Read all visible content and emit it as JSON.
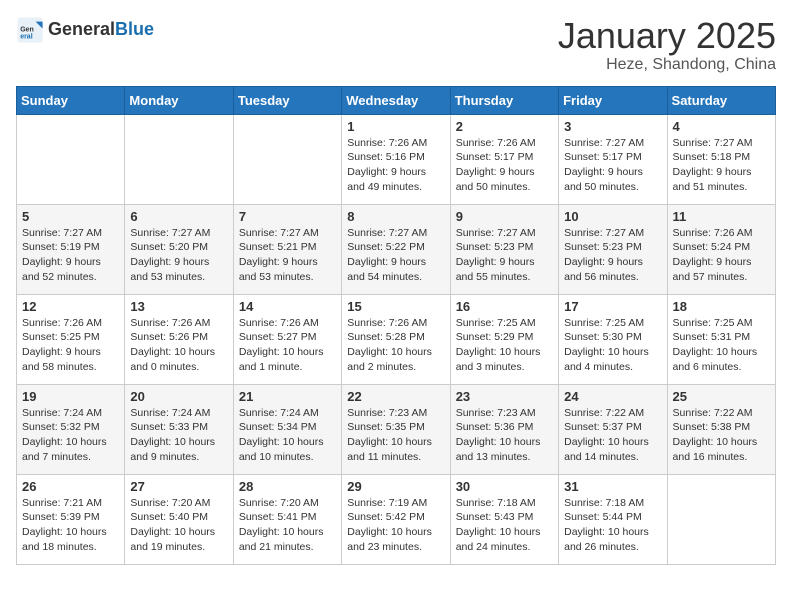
{
  "logo": {
    "general": "General",
    "blue": "Blue"
  },
  "title": "January 2025",
  "location": "Heze, Shandong, China",
  "days_of_week": [
    "Sunday",
    "Monday",
    "Tuesday",
    "Wednesday",
    "Thursday",
    "Friday",
    "Saturday"
  ],
  "weeks": [
    [
      {
        "day": "",
        "info": ""
      },
      {
        "day": "",
        "info": ""
      },
      {
        "day": "",
        "info": ""
      },
      {
        "day": "1",
        "info": "Sunrise: 7:26 AM\nSunset: 5:16 PM\nDaylight: 9 hours\nand 49 minutes."
      },
      {
        "day": "2",
        "info": "Sunrise: 7:26 AM\nSunset: 5:17 PM\nDaylight: 9 hours\nand 50 minutes."
      },
      {
        "day": "3",
        "info": "Sunrise: 7:27 AM\nSunset: 5:17 PM\nDaylight: 9 hours\nand 50 minutes."
      },
      {
        "day": "4",
        "info": "Sunrise: 7:27 AM\nSunset: 5:18 PM\nDaylight: 9 hours\nand 51 minutes."
      }
    ],
    [
      {
        "day": "5",
        "info": "Sunrise: 7:27 AM\nSunset: 5:19 PM\nDaylight: 9 hours\nand 52 minutes."
      },
      {
        "day": "6",
        "info": "Sunrise: 7:27 AM\nSunset: 5:20 PM\nDaylight: 9 hours\nand 53 minutes."
      },
      {
        "day": "7",
        "info": "Sunrise: 7:27 AM\nSunset: 5:21 PM\nDaylight: 9 hours\nand 53 minutes."
      },
      {
        "day": "8",
        "info": "Sunrise: 7:27 AM\nSunset: 5:22 PM\nDaylight: 9 hours\nand 54 minutes."
      },
      {
        "day": "9",
        "info": "Sunrise: 7:27 AM\nSunset: 5:23 PM\nDaylight: 9 hours\nand 55 minutes."
      },
      {
        "day": "10",
        "info": "Sunrise: 7:27 AM\nSunset: 5:23 PM\nDaylight: 9 hours\nand 56 minutes."
      },
      {
        "day": "11",
        "info": "Sunrise: 7:26 AM\nSunset: 5:24 PM\nDaylight: 9 hours\nand 57 minutes."
      }
    ],
    [
      {
        "day": "12",
        "info": "Sunrise: 7:26 AM\nSunset: 5:25 PM\nDaylight: 9 hours\nand 58 minutes."
      },
      {
        "day": "13",
        "info": "Sunrise: 7:26 AM\nSunset: 5:26 PM\nDaylight: 10 hours\nand 0 minutes."
      },
      {
        "day": "14",
        "info": "Sunrise: 7:26 AM\nSunset: 5:27 PM\nDaylight: 10 hours\nand 1 minute."
      },
      {
        "day": "15",
        "info": "Sunrise: 7:26 AM\nSunset: 5:28 PM\nDaylight: 10 hours\nand 2 minutes."
      },
      {
        "day": "16",
        "info": "Sunrise: 7:25 AM\nSunset: 5:29 PM\nDaylight: 10 hours\nand 3 minutes."
      },
      {
        "day": "17",
        "info": "Sunrise: 7:25 AM\nSunset: 5:30 PM\nDaylight: 10 hours\nand 4 minutes."
      },
      {
        "day": "18",
        "info": "Sunrise: 7:25 AM\nSunset: 5:31 PM\nDaylight: 10 hours\nand 6 minutes."
      }
    ],
    [
      {
        "day": "19",
        "info": "Sunrise: 7:24 AM\nSunset: 5:32 PM\nDaylight: 10 hours\nand 7 minutes."
      },
      {
        "day": "20",
        "info": "Sunrise: 7:24 AM\nSunset: 5:33 PM\nDaylight: 10 hours\nand 9 minutes."
      },
      {
        "day": "21",
        "info": "Sunrise: 7:24 AM\nSunset: 5:34 PM\nDaylight: 10 hours\nand 10 minutes."
      },
      {
        "day": "22",
        "info": "Sunrise: 7:23 AM\nSunset: 5:35 PM\nDaylight: 10 hours\nand 11 minutes."
      },
      {
        "day": "23",
        "info": "Sunrise: 7:23 AM\nSunset: 5:36 PM\nDaylight: 10 hours\nand 13 minutes."
      },
      {
        "day": "24",
        "info": "Sunrise: 7:22 AM\nSunset: 5:37 PM\nDaylight: 10 hours\nand 14 minutes."
      },
      {
        "day": "25",
        "info": "Sunrise: 7:22 AM\nSunset: 5:38 PM\nDaylight: 10 hours\nand 16 minutes."
      }
    ],
    [
      {
        "day": "26",
        "info": "Sunrise: 7:21 AM\nSunset: 5:39 PM\nDaylight: 10 hours\nand 18 minutes."
      },
      {
        "day": "27",
        "info": "Sunrise: 7:20 AM\nSunset: 5:40 PM\nDaylight: 10 hours\nand 19 minutes."
      },
      {
        "day": "28",
        "info": "Sunrise: 7:20 AM\nSunset: 5:41 PM\nDaylight: 10 hours\nand 21 minutes."
      },
      {
        "day": "29",
        "info": "Sunrise: 7:19 AM\nSunset: 5:42 PM\nDaylight: 10 hours\nand 23 minutes."
      },
      {
        "day": "30",
        "info": "Sunrise: 7:18 AM\nSunset: 5:43 PM\nDaylight: 10 hours\nand 24 minutes."
      },
      {
        "day": "31",
        "info": "Sunrise: 7:18 AM\nSunset: 5:44 PM\nDaylight: 10 hours\nand 26 minutes."
      },
      {
        "day": "",
        "info": ""
      }
    ]
  ]
}
